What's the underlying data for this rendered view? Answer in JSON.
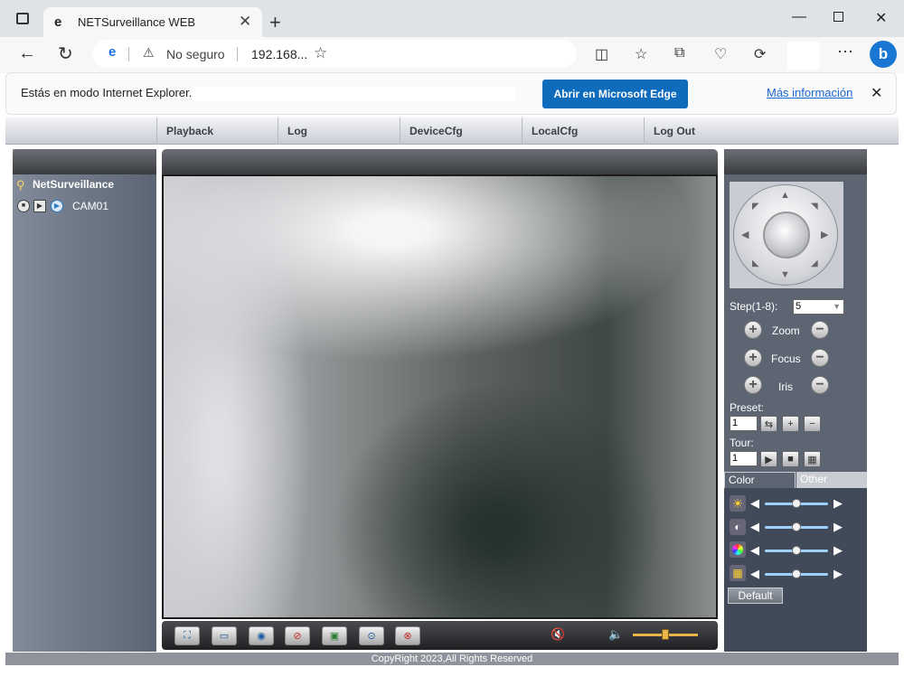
{
  "browser": {
    "tab_title": "NETSurveillance WEB",
    "address_security": "No seguro",
    "address_url": "192.168...",
    "infobar_message": "Estás en modo Internet Explorer.",
    "open_edge_button": "Abrir en Microsoft Edge",
    "more_info_link": "Más información"
  },
  "menu": {
    "items": [
      "Playback",
      "Log",
      "DeviceCfg",
      "LocalCfg",
      "Log Out"
    ]
  },
  "device_tree": {
    "root": "NetSurveillance",
    "camera": "CAM01"
  },
  "ptz": {
    "step_label": "Step(1-8):",
    "step_value": "5",
    "zoom_label": "Zoom",
    "focus_label": "Focus",
    "iris_label": "Iris",
    "preset_label": "Preset:",
    "preset_value": "1",
    "tour_label": "Tour:",
    "tour_value": "1"
  },
  "image_settings": {
    "tab_color": "Color",
    "tab_other": "Other",
    "default_button": "Default",
    "sliders": [
      {
        "icon": "brightness-icon",
        "level": 0.5
      },
      {
        "icon": "contrast-icon",
        "level": 0.5
      },
      {
        "icon": "saturation-icon",
        "level": 0.5
      },
      {
        "icon": "hue-icon",
        "level": 0.5
      }
    ]
  },
  "audio": {
    "volume_level": 0.5
  },
  "footer": {
    "copyright": "CopyRight 2023,All Rights Reserved"
  },
  "colors": {
    "accent_blue": "#0f6cbd",
    "panel_bg": "#5d6573",
    "link_blue": "#1967d2"
  }
}
